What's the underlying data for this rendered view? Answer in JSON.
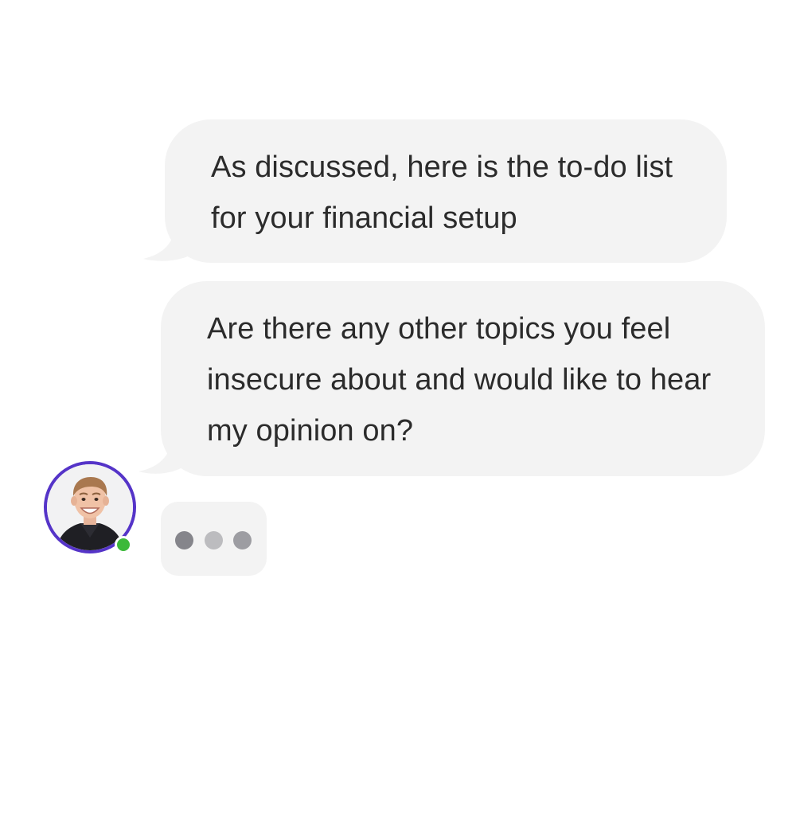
{
  "messages": [
    {
      "text": "As discussed, here is the to-do list for your financial setup"
    },
    {
      "text": "Are there any other topics you feel insecure about and would like to hear my opinion on?"
    }
  ],
  "colors": {
    "bubble": "#f3f3f3",
    "text": "#2b2b2b",
    "avatar_ring": "#5534c8",
    "online": "#3cb93a"
  },
  "typing_indicator": {
    "dot_colors": [
      "#85858b",
      "#bcbcbf",
      "#9d9da2"
    ]
  }
}
